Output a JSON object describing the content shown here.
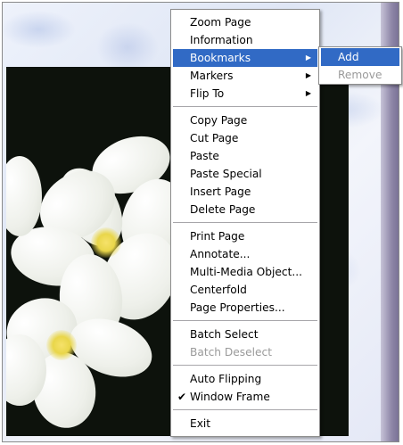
{
  "context_menu": {
    "items": [
      {
        "label": "Zoom Page"
      },
      {
        "label": "Information"
      },
      {
        "label": "Bookmarks",
        "submenu": true,
        "highlighted": true
      },
      {
        "label": "Markers",
        "submenu": true
      },
      {
        "label": "Flip To",
        "submenu": true
      },
      {
        "label": "Copy Page"
      },
      {
        "label": "Cut Page"
      },
      {
        "label": "Paste"
      },
      {
        "label": "Paste Special"
      },
      {
        "label": "Insert Page"
      },
      {
        "label": "Delete Page"
      },
      {
        "label": "Print Page"
      },
      {
        "label": "Annotate..."
      },
      {
        "label": "Multi-Media Object..."
      },
      {
        "label": "Centerfold"
      },
      {
        "label": "Page Properties..."
      },
      {
        "label": "Batch Select"
      },
      {
        "label": "Batch Deselect",
        "disabled": true
      },
      {
        "label": "Auto Flipping"
      },
      {
        "label": "Window Frame",
        "checked": true
      },
      {
        "label": "Exit"
      }
    ],
    "arrow_glyph": "▶",
    "check_glyph": "✔"
  },
  "bookmarks_submenu": {
    "items": [
      {
        "label": "Add",
        "highlighted": true
      },
      {
        "label": "Remove",
        "disabled": true
      }
    ]
  },
  "colors": {
    "highlight": "#316ac5",
    "disabled_text": "#9a9a9a"
  }
}
